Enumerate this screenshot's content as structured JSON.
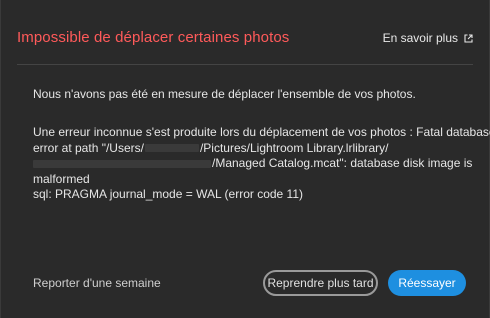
{
  "dialog": {
    "title": "Impossible de déplacer certaines photos",
    "learn_more": "En savoir plus",
    "message_summary": "Nous n'avons pas été en mesure de déplacer l'ensemble de vos photos.",
    "error": {
      "line1": "Une erreur inconnue s'est produite lors du déplacement de vos photos : Fatal database",
      "line2_prefix": "error at path \"/Users/",
      "line2_suffix": "/Pictures/Lightroom Library.lrlibrary/",
      "line3_suffix": "/Managed Catalog.mcat\": database disk image is",
      "line4": "malformed",
      "line5": "sql: PRAGMA journal_mode = WAL (error code 11)"
    },
    "footer_link": "Reporter d'une semaine",
    "secondary_button": "Reprendre plus tard",
    "primary_button": "Réessayer"
  },
  "icons": {
    "learn_more_icon": "external-link-icon"
  },
  "colors": {
    "background": "#2a2a2a",
    "title": "#ff5a5a",
    "primary": "#1e8fe0",
    "secondary_border": "#9a9a9a",
    "redaction": "#3a3a3a"
  }
}
